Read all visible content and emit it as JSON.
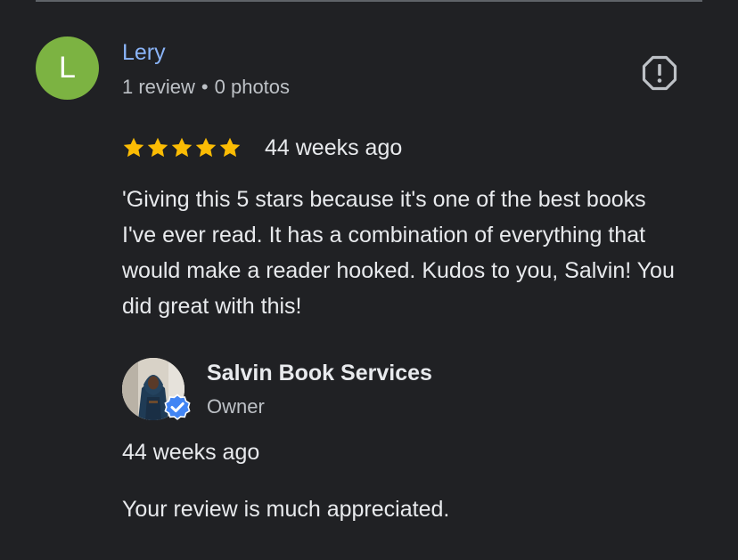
{
  "review": {
    "avatar_initial": "L",
    "avatar_color": "#7cb342",
    "reviewer_name": "Lery",
    "review_count": "1 review",
    "separator": "•",
    "photo_count": "0 photos",
    "rating": 5,
    "rating_max": 5,
    "time_ago": "44 weeks ago",
    "text": "'Giving this 5 stars because it's one of the best books I've ever read. It has a combination of everything that would make a reader hooked. Kudos to you, Salvin! You did great with this!",
    "report_icon": "report-flag-icon"
  },
  "owner_reply": {
    "owner_name": "Salvin Book Services",
    "role": "Owner",
    "verified_icon": "verified-check-icon",
    "time_ago": "44 weeks ago",
    "text": "Your review is much appreciated."
  },
  "colors": {
    "background": "#202124",
    "reviewer_name": "#8ab4f8",
    "star": "#fbbc04",
    "verified": "#4285f4"
  }
}
